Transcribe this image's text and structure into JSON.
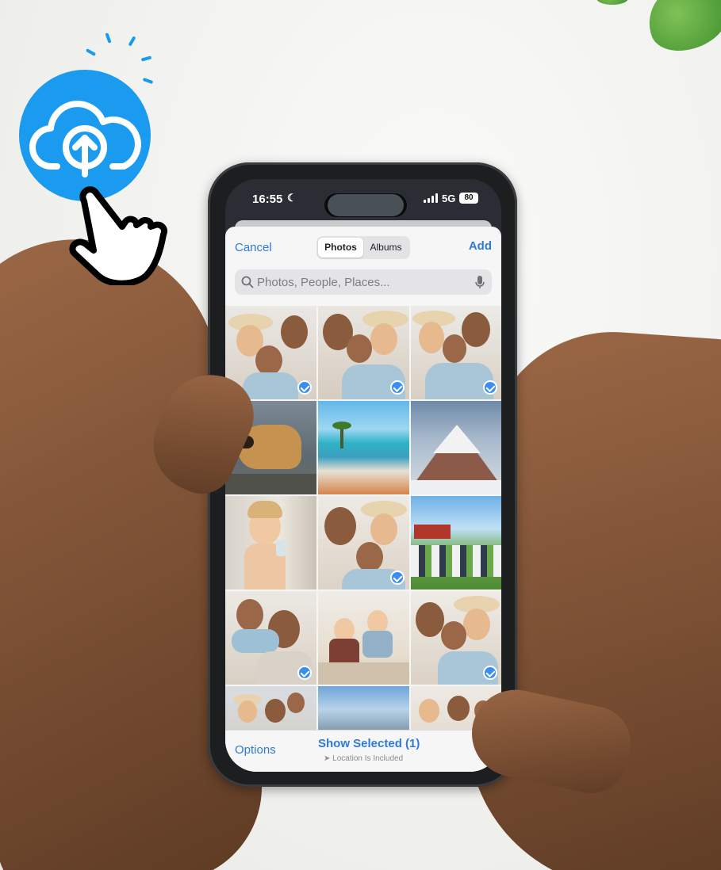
{
  "status": {
    "time": "16:55",
    "network": "5G",
    "battery": "80"
  },
  "picker": {
    "cancel_label": "Cancel",
    "add_label": "Add",
    "tabs": [
      {
        "label": "Photos",
        "selected": true
      },
      {
        "label": "Albums",
        "selected": false
      }
    ],
    "search_placeholder": "Photos, People, Places...",
    "photos": [
      {
        "subject": "family-selfie",
        "selected": true
      },
      {
        "subject": "family-selfie",
        "selected": true
      },
      {
        "subject": "family-selfie",
        "selected": true
      },
      {
        "subject": "dog",
        "selected": false
      },
      {
        "subject": "beach-resort",
        "selected": false
      },
      {
        "subject": "mountain",
        "selected": false
      },
      {
        "subject": "toddler",
        "selected": false
      },
      {
        "subject": "family-selfie",
        "selected": true
      },
      {
        "subject": "picnic-park",
        "selected": false
      },
      {
        "subject": "family-hug",
        "selected": true
      },
      {
        "subject": "kids-kitchen",
        "selected": false
      },
      {
        "subject": "family-selfie",
        "selected": true
      },
      {
        "subject": "family-beach",
        "selected": false
      },
      {
        "subject": "mountain-lake",
        "selected": false
      },
      {
        "subject": "family-selfie",
        "selected": false
      }
    ],
    "toolbar": {
      "options_label": "Options",
      "show_selected_label": "Show Selected (1)",
      "location_label": "Location Is Included"
    }
  },
  "colors": {
    "accent": "#2f7ad6",
    "upload_badge": "#1a9bef",
    "check": "#3b8ef0"
  },
  "overlay_icons": [
    "cloud-upload-icon",
    "pointing-hand-icon"
  ]
}
